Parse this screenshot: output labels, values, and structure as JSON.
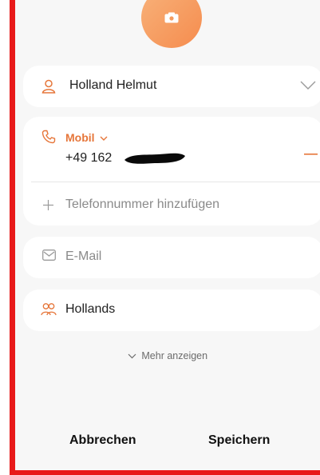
{
  "contact": {
    "name": "Holland  Helmut",
    "phone_type": "Mobil",
    "phone_number": "+49 162",
    "add_phone_label": "Telefonnummer hinzufügen",
    "email_placeholder": "E-Mail",
    "group": "Hollands"
  },
  "more_label": "Mehr anzeigen",
  "actions": {
    "cancel": "Abbrechen",
    "save": "Speichern"
  },
  "colors": {
    "accent": "#e6763a",
    "frame": "#e81a1a"
  },
  "icons": {
    "photo": "camera-icon",
    "person": "person-icon",
    "expand": "chevron-down-icon",
    "phone": "phone-icon",
    "remove": "minus-icon",
    "add": "plus-icon",
    "email": "mail-icon",
    "group": "group-icon"
  }
}
